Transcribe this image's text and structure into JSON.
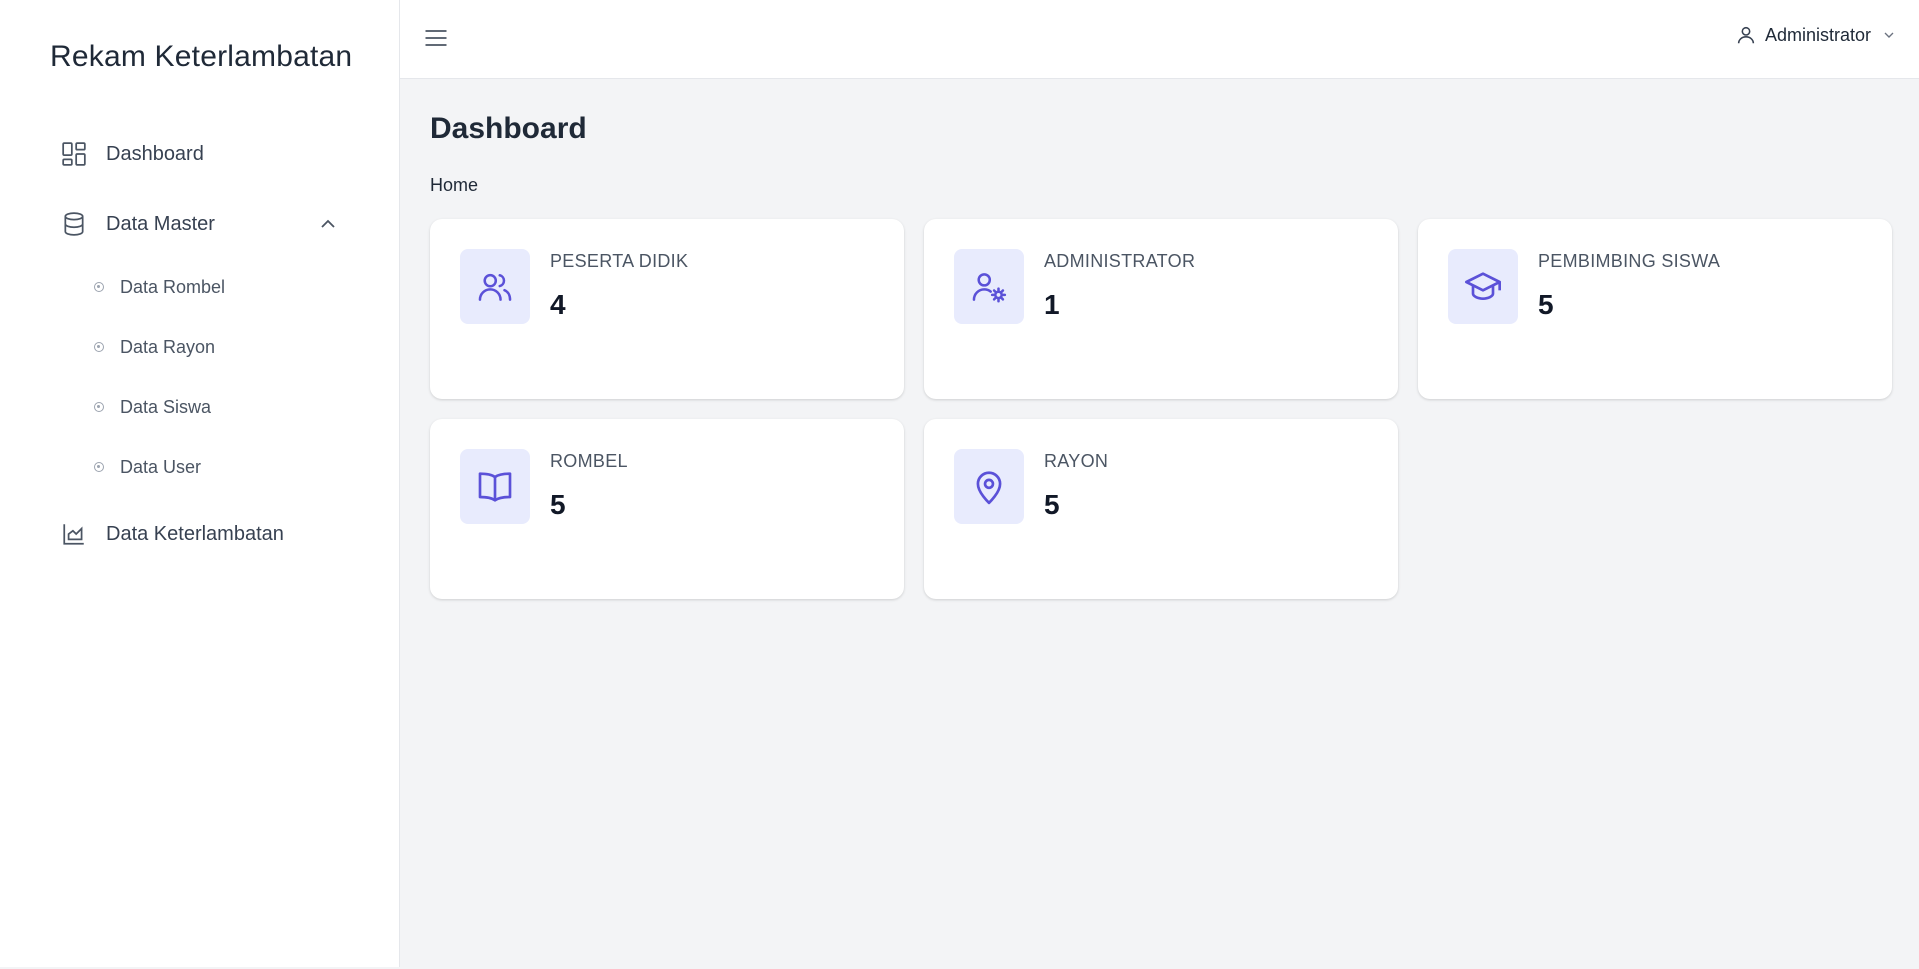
{
  "app": {
    "brand": "Rekam Keterlambatan"
  },
  "sidebar": {
    "items": [
      {
        "label": "Dashboard",
        "icon": "dashboard-grid-icon"
      },
      {
        "label": "Data Master",
        "icon": "database-icon",
        "expanded": true,
        "children": [
          {
            "label": "Data Rombel"
          },
          {
            "label": "Data Rayon"
          },
          {
            "label": "Data Siswa"
          },
          {
            "label": "Data User"
          }
        ]
      },
      {
        "label": "Data Keterlambatan",
        "icon": "chart-area-icon"
      }
    ]
  },
  "header": {
    "user_label": "Administrator"
  },
  "main": {
    "title": "Dashboard",
    "breadcrumb": "Home",
    "cards": [
      {
        "title": "PESERTA DIDIK",
        "value": "4",
        "icon": "users-icon"
      },
      {
        "title": "ADMINISTRATOR",
        "value": "1",
        "icon": "user-gear-icon"
      },
      {
        "title": "PEMBIMBING SISWA",
        "value": "5",
        "icon": "graduation-cap-icon"
      },
      {
        "title": "ROMBEL",
        "value": "5",
        "icon": "book-open-icon"
      },
      {
        "title": "RAYON",
        "value": "5",
        "icon": "map-pin-icon"
      }
    ]
  },
  "colors": {
    "accent": "#5b51d8",
    "icon_bg": "#e8ebfd",
    "page_bg": "#f3f4f6"
  }
}
